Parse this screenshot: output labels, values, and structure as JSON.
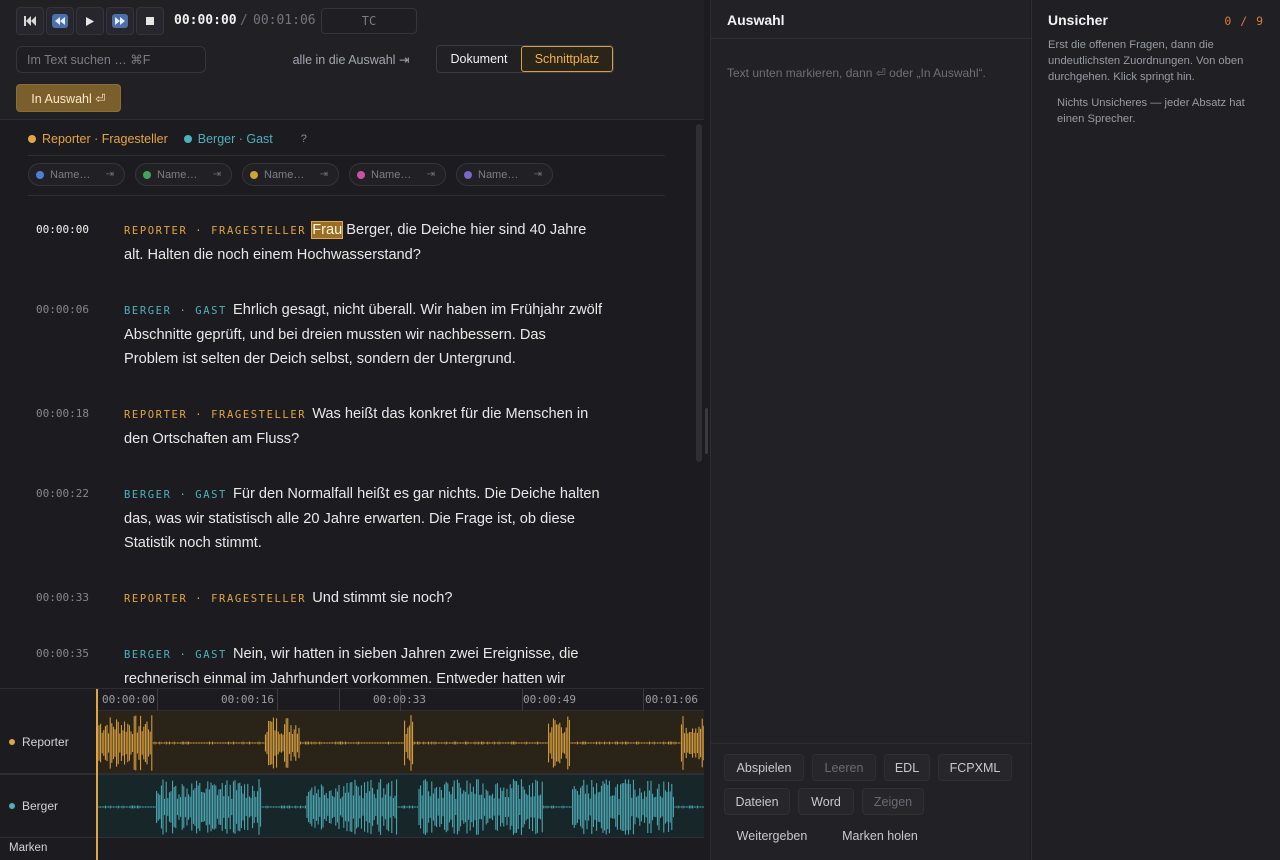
{
  "colors": {
    "reporter": "#e2a544",
    "berger": "#4fb0bd",
    "chip_dots": [
      "#4d7fd6",
      "#43a35d",
      "#cda33a",
      "#c555a4",
      "#7c64c9"
    ]
  },
  "transport": {
    "first_icon": "skip-to-start-icon",
    "rewind_icon": "rewind-icon",
    "play_icon": "play-icon",
    "forward_icon": "fast-forward-icon",
    "stop_icon": "stop-icon",
    "current_time": "00:00:00",
    "separator": "/",
    "total_time": "00:01:06",
    "tc_placeholder": "TC"
  },
  "search": {
    "placeholder": "Im Text suchen … ⌘F"
  },
  "toolbar": {
    "all_to_selection": "alle in die Auswahl ⇥",
    "view_document": "Dokument",
    "view_cutting": "Schnittplatz",
    "in_selection": "In Auswahl ⏎"
  },
  "speakers": {
    "items": [
      {
        "label": "Reporter · Fragesteller"
      },
      {
        "label": "Berger · Gast"
      }
    ],
    "help": "?"
  },
  "name_chips": {
    "placeholder": "Name…",
    "tab_glyph": "⇥"
  },
  "transcript": [
    {
      "time": "00:00:00",
      "speaker": "Reporter · Fragesteller",
      "highlight": "Frau",
      "text": " Berger, die Deiche hier sind 40 Jahre alt. Halten die noch einem Hochwasserstand?"
    },
    {
      "time": "00:00:06",
      "speaker": "Berger · Gast",
      "text": "Ehrlich gesagt, nicht überall. Wir haben im Frühjahr zwölf Abschnitte geprüft, und bei dreien mussten wir nachbessern. Das Problem ist selten der Deich selbst, sondern der Untergrund."
    },
    {
      "time": "00:00:18",
      "speaker": "Reporter · Fragesteller",
      "text": "Was heißt das konkret für die Menschen in den Ortschaften am Fluss?"
    },
    {
      "time": "00:00:22",
      "speaker": "Berger · Gast",
      "text": "Für den Normalfall heißt es gar nichts. Die Deiche halten das, was wir statistisch alle 20 Jahre erwarten. Die Frage ist, ob diese Statistik noch stimmt."
    },
    {
      "time": "00:00:33",
      "speaker": "Reporter · Fragesteller",
      "text": "Und stimmt sie noch?"
    },
    {
      "time": "00:00:35",
      "speaker": "Berger · Gast",
      "text": "Nein, wir hatten in sieben Jahren zwei Ereignisse, die rechnerisch einmal im Jahrhundert vorkommen. Entweder hatten wir"
    }
  ],
  "timeline": {
    "ticks": [
      "00:00:00",
      "00:00:16",
      "00:00:33",
      "00:00:49",
      "00:01:06"
    ],
    "tracks": [
      {
        "label": "Reporter"
      },
      {
        "label": "Berger"
      }
    ],
    "marks_label": "Marken"
  },
  "selection": {
    "title": "Auswahl",
    "hint": "Text unten markieren, dann ⏎ oder „In Auswahl“.",
    "buttons": {
      "play": "Abspielen",
      "clear": "Leeren",
      "edl": "EDL",
      "fcpxml": "FCPXML",
      "files": "Dateien",
      "word": "Word",
      "show": "Zeigen",
      "share": "Weitergeben",
      "fetch_marks": "Marken holen"
    }
  },
  "uncertain": {
    "title": "Unsicher",
    "count": "0 / 9",
    "description": "Erst die offenen Fragen, dann die undeutlichsten Zuordnungen. Von oben durchgehen. Klick springt hin.",
    "empty": "Nichts Unsicheres — jeder Absatz hat einen Sprecher."
  }
}
